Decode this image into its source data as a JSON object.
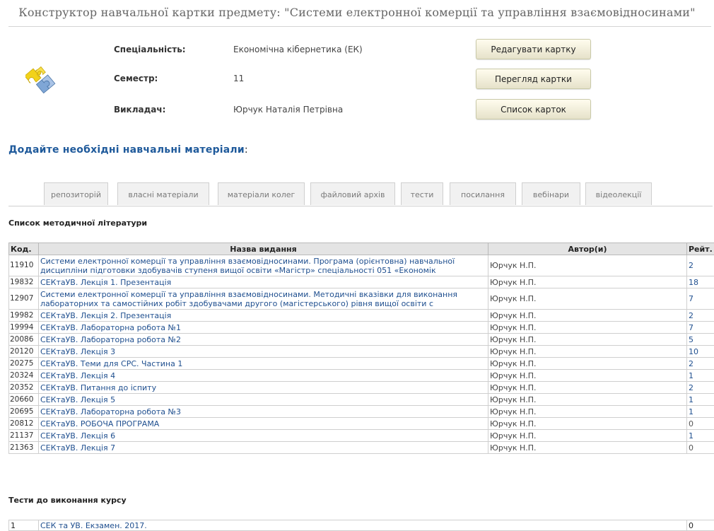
{
  "header": {
    "title": "Конструктор навчальної картки предмету: \"Системи електронної комерції та управління взаємовідносинами\""
  },
  "info": {
    "specialty_label": "Спеціальність:",
    "specialty_value": "Економічна кібернетика (ЕК)",
    "semester_label": "Семестр:",
    "semester_value": "11",
    "teacher_label": "Викладач:",
    "teacher_value": "Юрчук Наталія Петрівна"
  },
  "actions": {
    "edit_label": "Редагувати картку",
    "view_label": "Перегляд картки",
    "list_label": "Список карток"
  },
  "materials": {
    "heading": "Додайте необхідні навчальні матеріали",
    "heading_colon": ":"
  },
  "tabs": [
    {
      "label": "репозиторій"
    },
    {
      "label": "власні матеріали"
    },
    {
      "label": "матеріали колег"
    },
    {
      "label": "файловий архів"
    },
    {
      "label": "тести"
    },
    {
      "label": "посилання"
    },
    {
      "label": "вебінари"
    },
    {
      "label": "відеолекції"
    }
  ],
  "literature": {
    "section_title": "Список методичної літератури",
    "columns": {
      "code": "Код.",
      "name": "Назва видання",
      "author": "Автор(и)",
      "rating": "Рейт."
    },
    "rows": [
      {
        "code": "11910",
        "name": "Системи електронної комерції та управління взаємовідносинами. Програма (орієнтовна) навчальної дисципліни підготовки здобувачів ступеня вищої освіти «Магістр» спеціальності 051 «Економік",
        "author": "Юрчук Н.П.",
        "rating": "2"
      },
      {
        "code": "19832",
        "name": "СЕКтаУВ. Лекція 1. Презентація",
        "author": "Юрчук Н.П.",
        "rating": "18"
      },
      {
        "code": "12907",
        "name": "Системи електронної комерції та управління взаємовідносинами. Методичні вказівки для виконання лабораторних та самостійних робіт здобувачами другого (магістерського) рівня вищої освіти с",
        "author": "Юрчук Н.П.",
        "rating": "7"
      },
      {
        "code": "19982",
        "name": "СЕКтаУВ. Лекція 2. Презентація",
        "author": "Юрчук Н.П.",
        "rating": "2"
      },
      {
        "code": "19994",
        "name": "СЕКтаУВ. Лабораторна робота №1",
        "author": "Юрчук Н.П.",
        "rating": "7"
      },
      {
        "code": "20086",
        "name": "СЕКтаУВ. Лабораторна робота №2",
        "author": "Юрчук Н.П.",
        "rating": "5"
      },
      {
        "code": "20120",
        "name": "СЕКтаУВ. Лекція 3",
        "author": "Юрчук Н.П.",
        "rating": "10"
      },
      {
        "code": "20275",
        "name": "СЕКтаУВ. Теми для СРС. Частина 1",
        "author": "Юрчук Н.П.",
        "rating": "2"
      },
      {
        "code": "20324",
        "name": "СЕКтаУВ. Лекція 4",
        "author": "Юрчук Н.П.",
        "rating": "1"
      },
      {
        "code": "20352",
        "name": "СЕКтаУВ. Питання до іспиту",
        "author": "Юрчук Н.П.",
        "rating": "2"
      },
      {
        "code": "20660",
        "name": "СЕКтаУВ. Лекція 5",
        "author": "Юрчук Н.П.",
        "rating": "1"
      },
      {
        "code": "20695",
        "name": "СЕКтаУВ. Лабораторна робота №3",
        "author": "Юрчук Н.П.",
        "rating": "1"
      },
      {
        "code": "20812",
        "name": "СЕКтаУВ. РОБОЧА ПРОГРАМА",
        "author": "Юрчук Н.П.",
        "rating": "0"
      },
      {
        "code": "21137",
        "name": "СЕКтаУВ. Лекція 6",
        "author": "Юрчук Н.П.",
        "rating": "1"
      },
      {
        "code": "21363",
        "name": "СЕКтаУВ. Лекція 7",
        "author": "Юрчук Н.П.",
        "rating": "0"
      }
    ]
  },
  "tests": {
    "section_title": "Тести до виконання курсу",
    "rows": [
      {
        "code": "1",
        "name": "СЕК та УВ. Екзамен. 2017.",
        "rating": "0"
      }
    ]
  },
  "colors": {
    "link": "#1f4f8f",
    "heading_blue": "#1f5a9b",
    "button_bg": "#f3efd9",
    "tab_bg": "#f1f1f1",
    "header_bg": "#e4e4e4"
  },
  "icons": {
    "logo": "puzzle-icon"
  }
}
